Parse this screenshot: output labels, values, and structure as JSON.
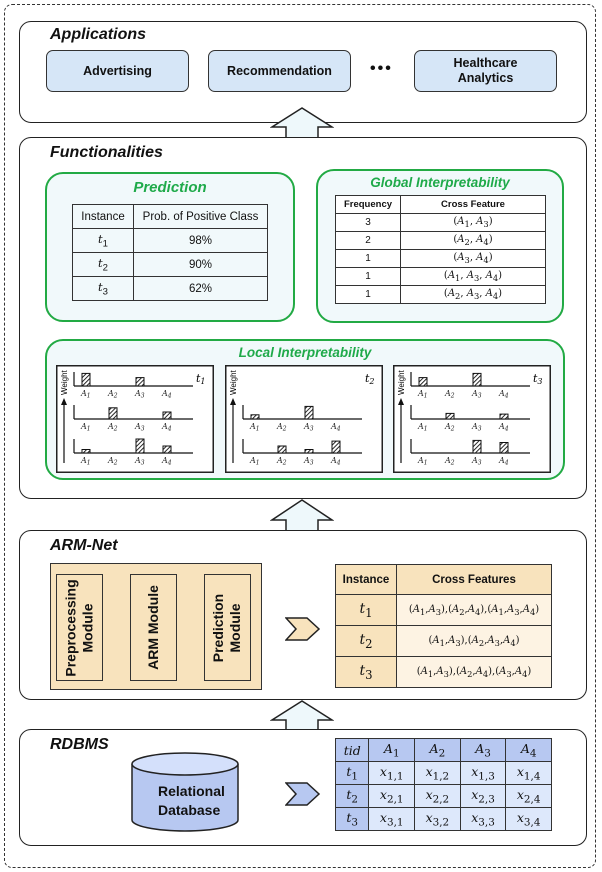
{
  "applications": {
    "title": "Applications",
    "items": [
      "Advertising",
      "Recommendation",
      "Healthcare Analytics"
    ],
    "ellipsis": "•••"
  },
  "functionalities": {
    "title": "Functionalities",
    "prediction": {
      "title": "Prediction",
      "headers": [
        "Instance",
        "Prob. of Positive Class"
      ],
      "rows": [
        {
          "instance": "t",
          "sub": "1",
          "prob": "98%"
        },
        {
          "instance": "t",
          "sub": "2",
          "prob": "90%"
        },
        {
          "instance": "t",
          "sub": "3",
          "prob": "62%"
        }
      ]
    },
    "global": {
      "title": "Global Interpretability",
      "headers": [
        "Frequency",
        "Cross Feature"
      ],
      "rows": [
        {
          "freq": "3",
          "feature": "(A1, A3)"
        },
        {
          "freq": "2",
          "feature": "(A2, A4)"
        },
        {
          "freq": "1",
          "feature": "(A3, A4)"
        },
        {
          "freq": "1",
          "feature": "(A1, A3, A4)"
        },
        {
          "freq": "1",
          "feature": "(A2, A3, A4)"
        }
      ]
    },
    "local": {
      "title": "Local Interpretability",
      "axis_label": "Weight",
      "attributes": [
        "A1",
        "A2",
        "A3",
        "A4"
      ],
      "panels": [
        {
          "instance": "t1",
          "charts": [
            [
              0.9,
              0,
              0.6,
              0
            ],
            [
              0,
              0.8,
              0,
              0.5
            ],
            [
              0.25,
              0,
              1.0,
              0.5
            ]
          ]
        },
        {
          "instance": "t2",
          "charts": [
            [
              0.3,
              0,
              0.9,
              0
            ],
            [
              0,
              0.5,
              0.25,
              0.85
            ]
          ]
        },
        {
          "instance": "t3",
          "charts": [
            [
              0.6,
              0,
              0.9,
              0
            ],
            [
              0,
              0.4,
              0,
              0.35
            ],
            [
              0,
              0,
              0.9,
              0.75
            ]
          ]
        }
      ]
    }
  },
  "armnet": {
    "title": "ARM-Net",
    "modules": [
      "Preprocessing Module",
      "ARM Module",
      "Prediction Module"
    ],
    "table": {
      "headers": [
        "Instance",
        "Cross Features"
      ],
      "rows": [
        {
          "instance": "t1",
          "features": "(A1,A3),(A2,A4),(A1,A3,A4)"
        },
        {
          "instance": "t2",
          "features": "(A1,A3),(A2,A3,A4)"
        },
        {
          "instance": "t3",
          "features": "(A1,A3),(A2,A4),(A3,A4)"
        }
      ]
    }
  },
  "rdbms": {
    "title": "RDBMS",
    "database_label": "Relational Database",
    "table": {
      "headers": [
        "tid",
        "A1",
        "A2",
        "A3",
        "A4"
      ],
      "rows": [
        [
          "t1",
          "x1,1",
          "x1,2",
          "x1,3",
          "x1,4"
        ],
        [
          "t2",
          "x2,1",
          "x2,2",
          "x2,3",
          "x2,4"
        ],
        [
          "t3",
          "x3,1",
          "x3,2",
          "x3,3",
          "x3,4"
        ]
      ]
    }
  },
  "colors": {
    "app_blue": "#d6e6f7",
    "func_green": "#22aa44",
    "arm_tan": "#f8e3bd",
    "db_blue": "#b7c8f1"
  }
}
